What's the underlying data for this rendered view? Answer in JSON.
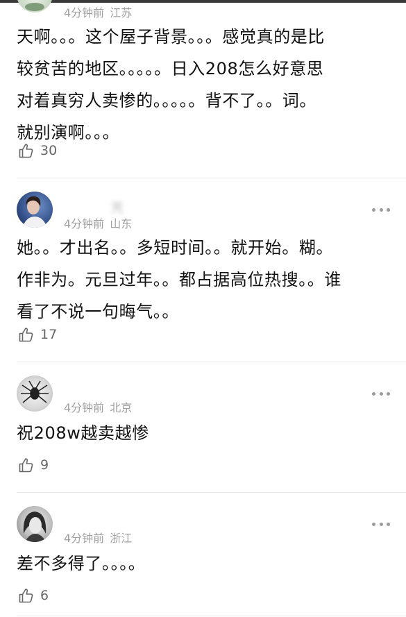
{
  "comments": [
    {
      "username": "",
      "time": "4分钟前",
      "location": "江苏",
      "lines": [
        "天啊。。。这个屋子背景。。。感觉真的是比",
        "较贫苦的地区。。。。。日入208怎么好意思",
        "对着真穷人卖惨的。。。。。背不了。。词。",
        "就别演啊。。。"
      ],
      "likes": "30"
    },
    {
      "username": "苀",
      "time": "4分钟前",
      "location": "山东",
      "lines": [
        "她。。才出名。。多短时间。。就开始。糊。",
        "作非为。元旦过年。。都占据高位热搜。。谁",
        "看了不说一句晦气。。"
      ],
      "likes": "17"
    },
    {
      "username": "",
      "time": "4分钟前",
      "location": "北京",
      "lines": [
        "祝208w越卖越惨"
      ],
      "likes": "9"
    },
    {
      "username": "",
      "time": "4分钟前",
      "location": "浙江",
      "lines": [
        "差不多得了。。。。"
      ],
      "likes": "6"
    }
  ],
  "icons": {
    "like": "thumbs-up-icon",
    "more": "more-options-icon"
  },
  "colors": {
    "text": "#111111",
    "meta": "#a0a0a0",
    "divider": "#e6e6e6",
    "icon": "#666666"
  }
}
